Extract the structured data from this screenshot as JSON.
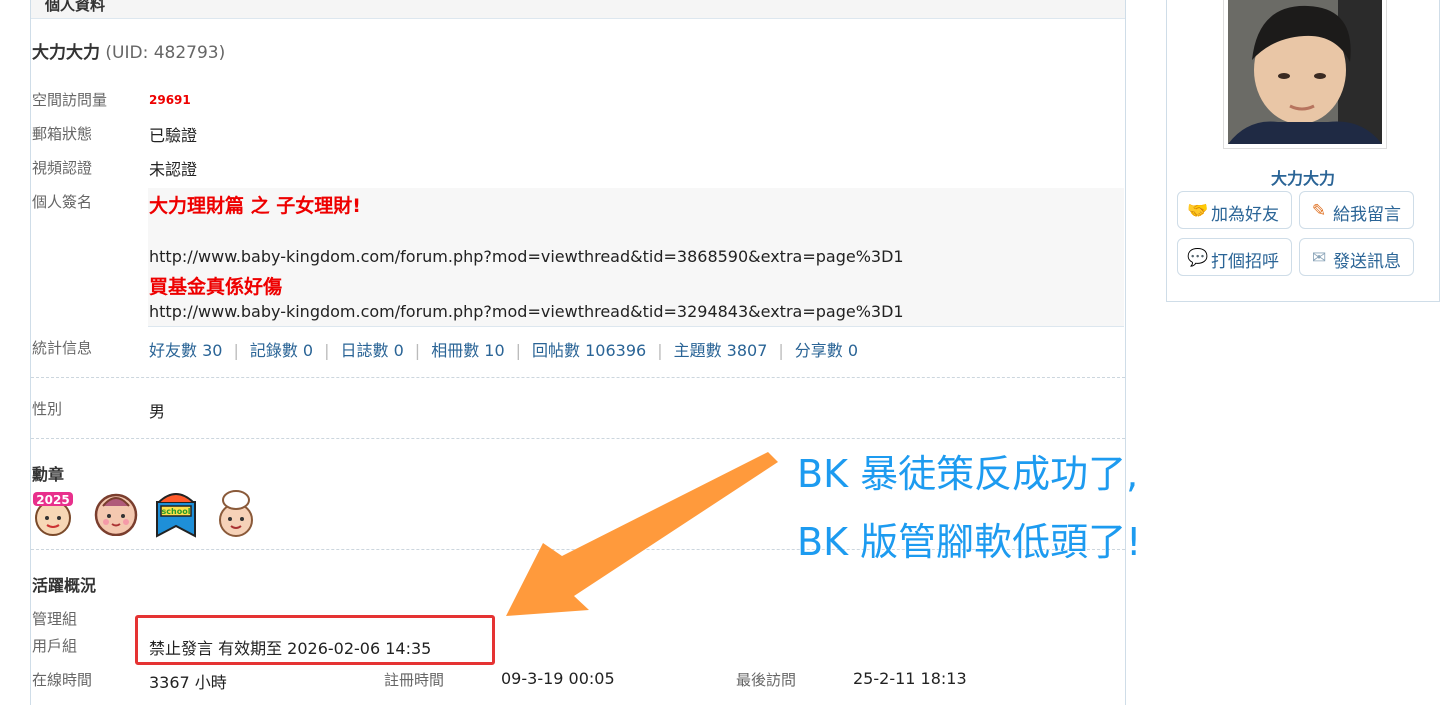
{
  "section_title": "個人資料",
  "profile": {
    "username": "大力大力",
    "uid_text": "(UID: 482793)"
  },
  "fields": {
    "visits_label": "空間訪問量",
    "visits_value": "29691",
    "email_label": "郵箱狀態",
    "email_value": "已驗證",
    "video_label": "視頻認證",
    "video_value": "未認證",
    "signature_label": "個人簽名",
    "stats_label": "統計信息",
    "gender_label": "性別",
    "gender_value": "男"
  },
  "signature": {
    "line1": "大力理財篇 之 子女理財!",
    "url1": "http://www.baby-kingdom.com/forum.php?mod=viewthread&tid=3868590&extra=page%3D1",
    "line2": "買基金真係好傷",
    "url2": "http://www.baby-kingdom.com/forum.php?mod=viewthread&tid=3294843&extra=page%3D1"
  },
  "stats": [
    {
      "label": "好友數 30"
    },
    {
      "label": "記錄數 0"
    },
    {
      "label": "日誌數 0"
    },
    {
      "label": "相冊數 10"
    },
    {
      "label": "回帖數 106396"
    },
    {
      "label": "主題數 3807"
    },
    {
      "label": "分享數 0"
    }
  ],
  "medals_title": "勳章",
  "medals": [
    {
      "icon": "medal-2025-icon"
    },
    {
      "icon": "baby-face-medal-icon"
    },
    {
      "icon": "school-medal-icon"
    },
    {
      "icon": "chef-baby-medal-icon"
    }
  ],
  "activity": {
    "title": "活躍概況",
    "admin_group_label": "管理組",
    "user_group_label": "用戶組",
    "user_group_value": "禁止發言  有效期至 2026-02-06 14:35",
    "online_label": "在線時間",
    "online_value": "3367 小時",
    "register_label": "註冊時間",
    "register_value": "09-3-19 00:05",
    "last_visit_label": "最後訪問",
    "last_visit_value": "25-2-11 18:13"
  },
  "sidebar": {
    "username": "大力大力",
    "buttons": [
      {
        "label": "加為好友",
        "icon": "handshake-icon"
      },
      {
        "label": "給我留言",
        "icon": "pencil-icon"
      },
      {
        "label": "打個招呼",
        "icon": "chat-bubble-icon"
      },
      {
        "label": "發送訊息",
        "icon": "envelope-icon"
      }
    ]
  },
  "annotation": {
    "line1": "BK 暴徒策反成功了,",
    "line2": "BK 版管腳軟低頭了!"
  },
  "colors": {
    "link": "#2a6496",
    "highlight_box": "#e53333",
    "arrow": "#ff9a3c",
    "annotation_text": "#1d9bf0",
    "signature_red": "#ee0000"
  }
}
